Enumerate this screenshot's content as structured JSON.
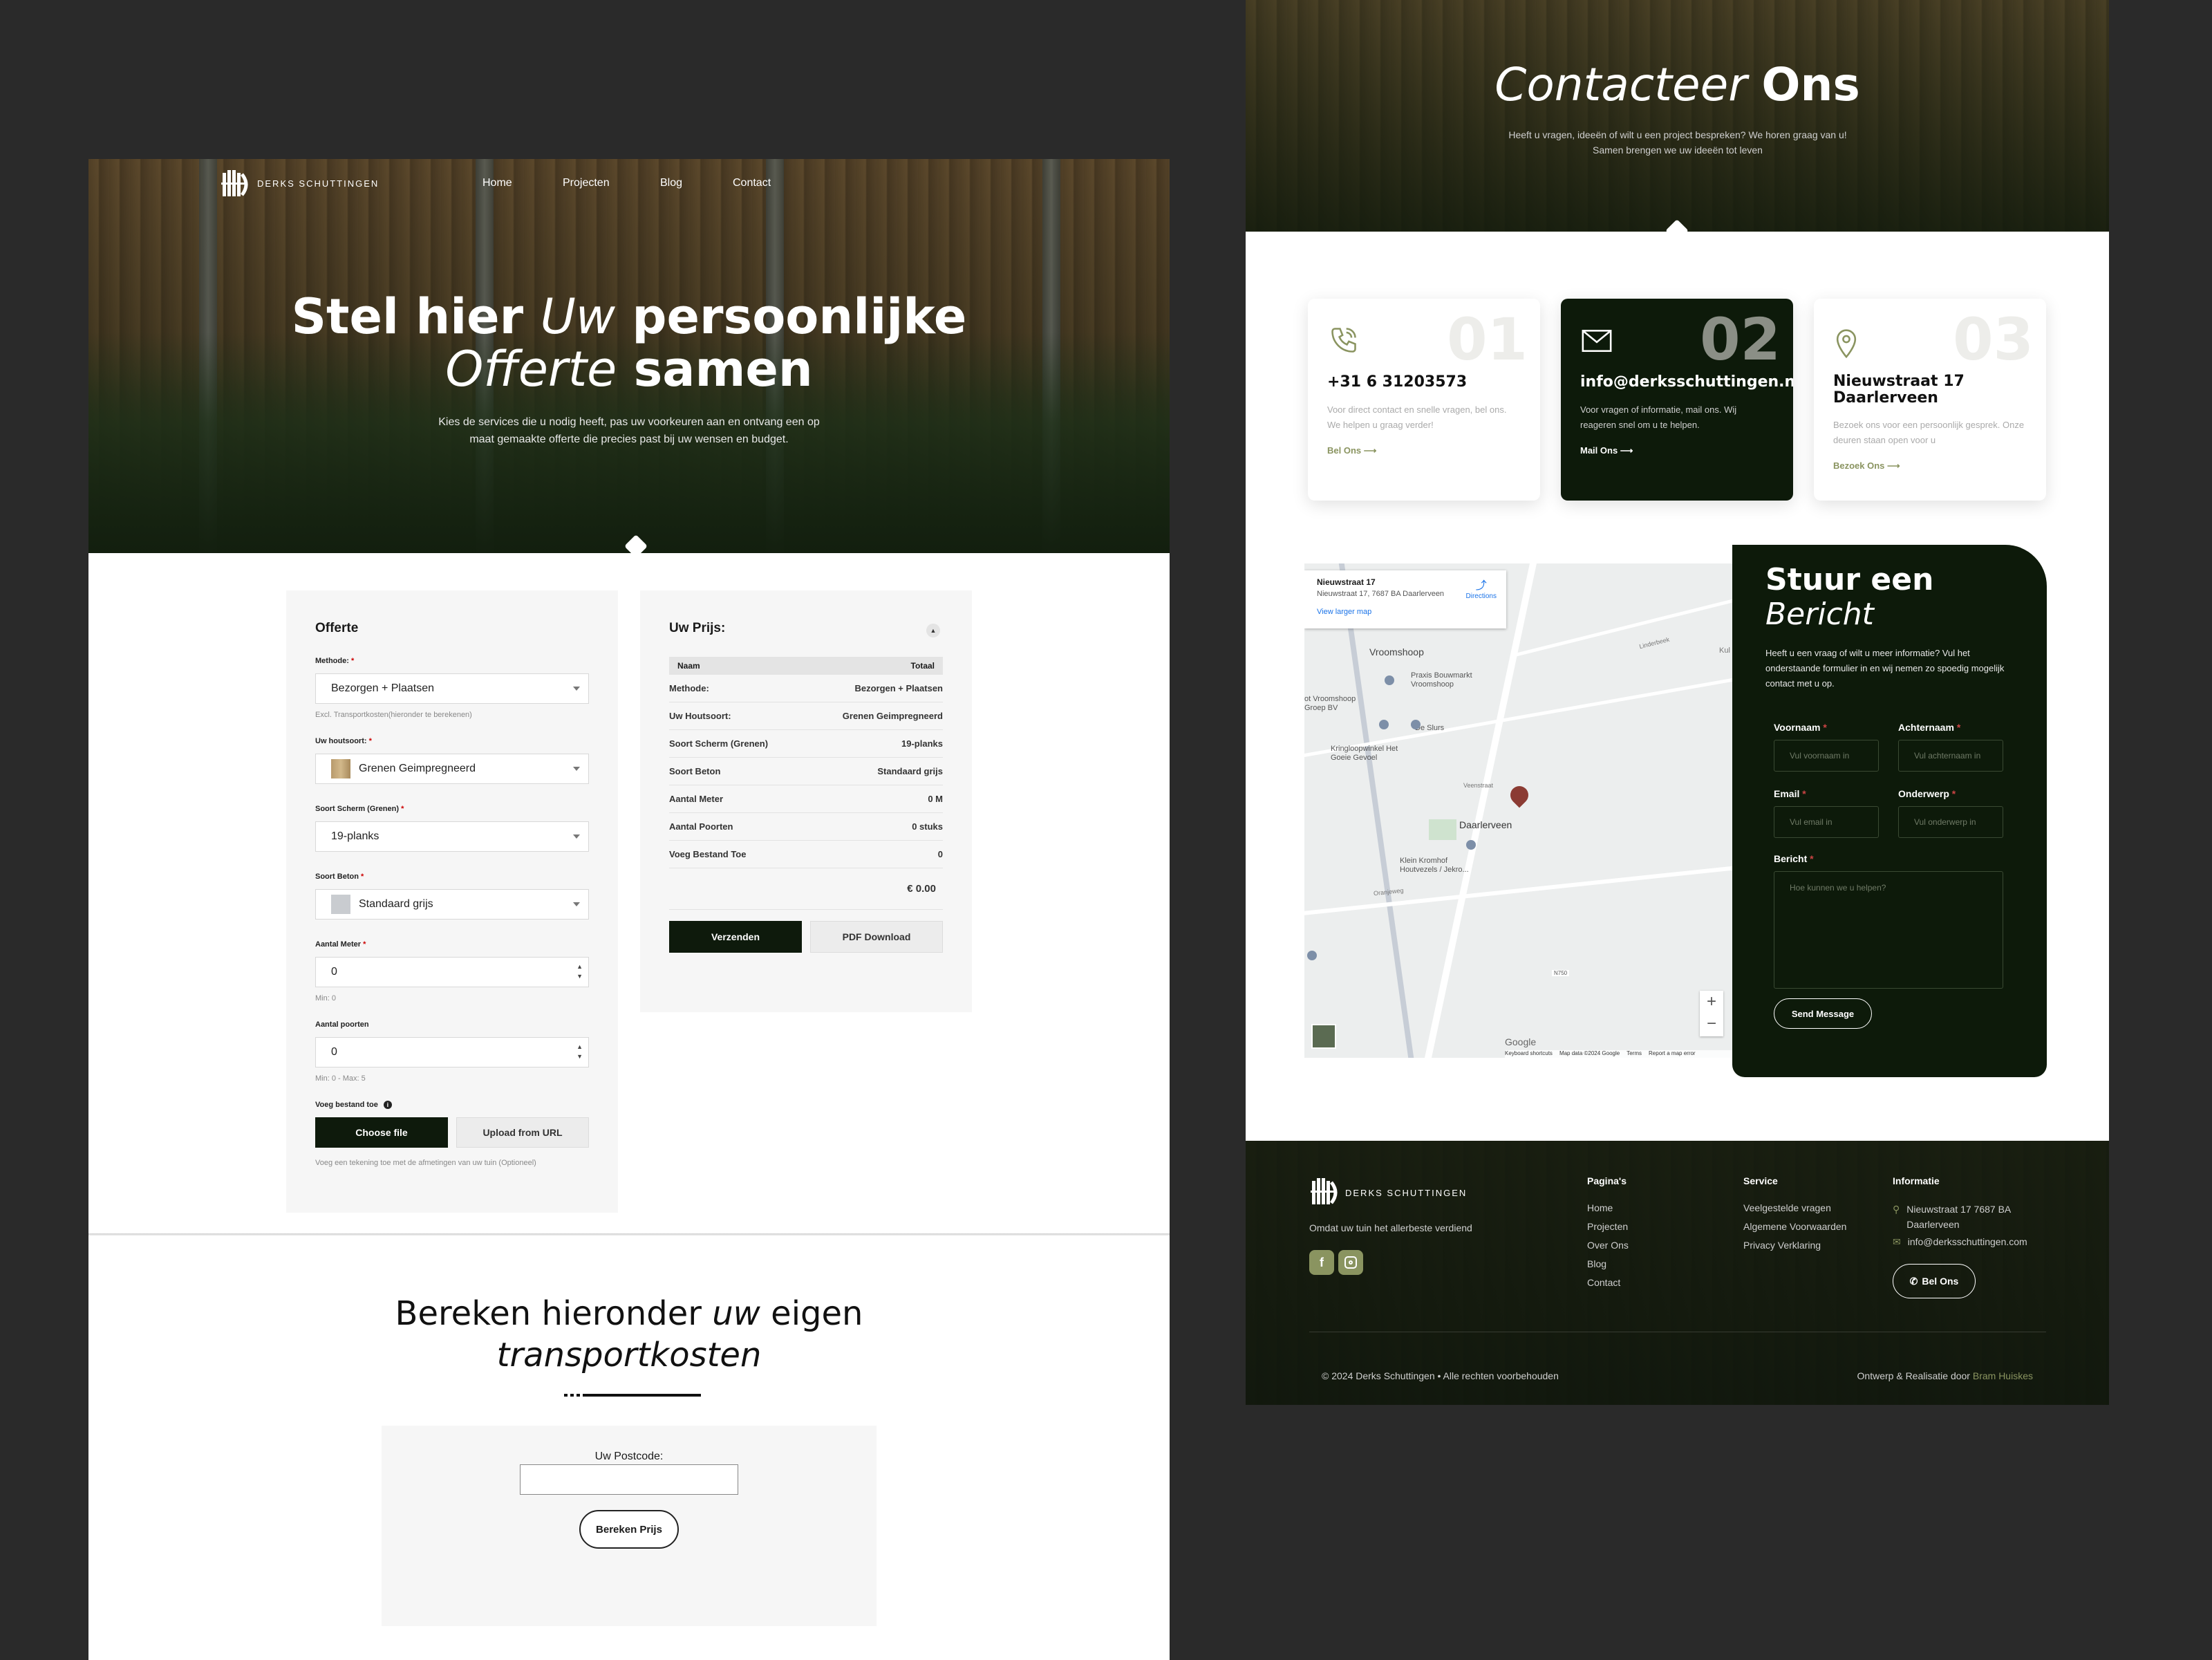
{
  "left": {
    "brand": "DERKS SCHUTTINGEN",
    "nav": [
      "Home",
      "Projecten",
      "Blog",
      "Contact"
    ],
    "hero": {
      "title_a": "Stel hier ",
      "title_b": "Uw",
      "title_c": " persoonlijke",
      "title_d": "Offerte",
      "title_e": " samen",
      "subtitle": "Kies de services die u nodig heeft, pas uw voorkeuren aan en ontvang een op maat gemaakte offerte die precies past bij uw wensen en budget."
    },
    "offerte": {
      "title": "Offerte",
      "methode_label": "Methode:",
      "methode_value": "Bezorgen + Plaatsen",
      "methode_hint": "Excl. Transportkosten(hieronder te berekenen)",
      "hout_label": "Uw houtsoort:",
      "hout_value": "Grenen Geimpregneerd",
      "scherm_label": "Soort Scherm (Grenen)",
      "scherm_value": "19-planks",
      "beton_label": "Soort Beton",
      "beton_value": "Standaard grijs",
      "meter_label": "Aantal Meter",
      "meter_value": "0",
      "meter_hint": "Min: 0",
      "poorten_label": "Aantal poorten",
      "poorten_value": "0",
      "poorten_hint": "Min: 0 - Max: 5",
      "file_label": "Voeg bestand toe",
      "choose_file": "Choose file",
      "upload_url": "Upload from URL",
      "file_hint": "Voeg een tekening toe met de afmetingen van uw tuin (Optioneel)",
      "required_mark": "*"
    },
    "prijs": {
      "title": "Uw Prijs:",
      "col_naam": "Naam",
      "col_totaal": "Totaal",
      "rows": [
        [
          "Methode:",
          "Bezorgen + Plaatsen"
        ],
        [
          "Uw Houtsoort:",
          "Grenen Geimpregneerd"
        ],
        [
          "Soort Scherm (Grenen)",
          "19-planks"
        ],
        [
          "Soort Beton",
          "Standaard grijs"
        ],
        [
          "Aantal Meter",
          "0 M"
        ],
        [
          "Aantal Poorten",
          "0 stuks"
        ],
        [
          "Voeg Bestand Toe",
          "0"
        ]
      ],
      "total": "€ 0.00",
      "send": "Verzenden",
      "pdf": "PDF Download"
    },
    "transport": {
      "title_a": "Bereken hieronder ",
      "title_b": "uw",
      "title_c": " eigen",
      "title_d": "transportkosten",
      "postcode_label": "Uw Postcode:",
      "button": "Bereken Prijs"
    }
  },
  "right": {
    "hero": {
      "title_a": "Contacteer ",
      "title_b": "Ons",
      "subtitle": "Heeft u vragen, ideeën of wilt u een project bespreken? We horen graag van u! Samen brengen we uw ideeën tot leven"
    },
    "cards": [
      {
        "num": "01",
        "title": "+31 6 31203573",
        "text": "Voor direct contact en snelle vragen, bel ons. We helpen u graag verder!",
        "link": "Bel Ons"
      },
      {
        "num": "02",
        "title": "info@derksschuttingen.nl",
        "text": "Voor vragen of informatie, mail ons. Wij reageren snel om u te helpen.",
        "link": "Mail Ons"
      },
      {
        "num": "03",
        "title": "Nieuwstraat 17 Daarlerveen",
        "text": "Bezoek ons voor een persoonlijk gesprek. Onze deuren staan open voor u",
        "link": "Bezoek Ons"
      }
    ],
    "map": {
      "place": "Nieuwstraat 17",
      "address": "Nieuwstraat 17, 7687 BA Daarlerveen",
      "directions": "Directions",
      "larger": "View larger map",
      "labels": [
        "Vroomshoop",
        "Praxis Bouwmarkt Vroomshoop",
        "De Slurs",
        "Kringloopwinkel Het Goeie Gevoel",
        "Daarlerveen",
        "Klein Kromhof Houtvezels / Jekro...",
        "ot Vroomshoop Groep BV",
        "Kul",
        "Linderbeek",
        "Veenstraat",
        "Oranjeweg",
        "N750"
      ],
      "footer": [
        "Keyboard shortcuts",
        "Map data ©2024 Google",
        "Terms",
        "Report a map error"
      ],
      "google": "Google"
    },
    "message": {
      "title_a": "Stuur een",
      "title_b": "Bericht",
      "text": "Heeft u een vraag of wilt u meer informatie? Vul het onderstaande formulier in en wij nemen zo spoedig mogelijk contact met u op.",
      "voornaam": "Voornaam",
      "voornaam_ph": "Vul voornaam in",
      "achternaam": "Achternaam",
      "achternaam_ph": "Vul achternaam in",
      "email": "Email",
      "email_ph": "Vul email in",
      "onderwerp": "Onderwerp",
      "onderwerp_ph": "Vul onderwerp in",
      "bericht": "Bericht",
      "bericht_ph": "Hoe kunnen we u helpen?",
      "send": "Send Message",
      "required_mark": "*"
    },
    "footer": {
      "brand": "DERKS SCHUTTINGEN",
      "tagline": "Omdat uw tuin het allerbeste verdiend",
      "paginas_title": "Pagina's",
      "paginas": [
        "Home",
        "Projecten",
        "Over Ons",
        "Blog",
        "Contact"
      ],
      "service_title": "Service",
      "service": [
        "Veelgestelde vragen",
        "Algemene Voorwaarden",
        "Privacy Verklaring"
      ],
      "info_title": "Informatie",
      "address": "Nieuwstraat 17 7687 BA Daarlerveen",
      "email": "info@derksschuttingen.com",
      "bel": "Bel Ons",
      "copyright": "© 2024 Derks Schuttingen • Alle rechten voorbehouden",
      "credit": "Ontwerp & Realisatie door ",
      "credit_name": "Bram Huiskes"
    }
  },
  "colors": {
    "dark_green": "#0d1a0a",
    "accent": "#8a9460",
    "panel": "#f6f6f6"
  }
}
